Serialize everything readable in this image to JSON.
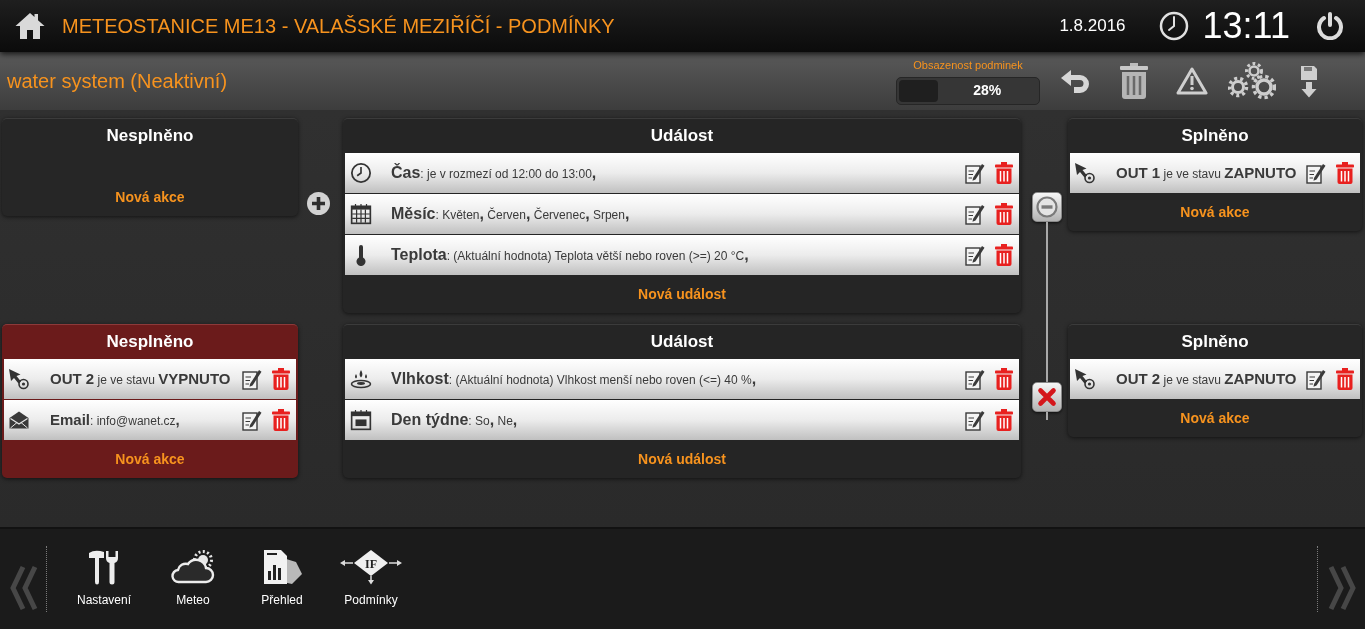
{
  "header": {
    "title": "METEOSTANICE ME13 - VALAŠSKÉ MEZIŘÍČÍ - PODMÍNKY",
    "date": "1.8.2016",
    "time": "13:11"
  },
  "toolbar": {
    "title": "water system (Neaktivní)",
    "occupancy": {
      "label": "Obsazenost podminek",
      "level": 0.28,
      "reading": "28%"
    }
  },
  "rules": [
    {
      "add_button": true,
      "link_button": {
        "kind": "remove"
      },
      "unmet": {
        "title": "Nesplněno",
        "active": false,
        "new_label": "Nová akce"
      },
      "event": {
        "title": "Událost",
        "conditions": [
          {
            "kind": "time",
            "text": "**Čas**: je v rozmezí od 12:00 do 13:00**,**"
          },
          {
            "kind": "month",
            "text": "**Měsíc**: Květen**,** Červen**,** Červenec**,** Srpen**,**"
          },
          {
            "kind": "temperature",
            "text": "**Teplota**: (Aktuální hodnota) Teplota větší nebo roven (>=) 20 °C**,**"
          }
        ],
        "new_label": "Nová událost"
      },
      "met": {
        "title": "Splněno",
        "active": false,
        "actions": [
          {
            "kind": "output",
            "text": "**OUT 1** je ve stavu **ZAPNUTO**"
          }
        ],
        "new_label": "Nová akce"
      }
    },
    {
      "link_button": {
        "kind": "delete"
      },
      "unmet": {
        "title": "Nesplněno",
        "active": true,
        "actions": [
          {
            "kind": "output",
            "text": "**OUT 2** je ve stavu **VYPNUTO**"
          },
          {
            "kind": "email",
            "text": "**Email**: info@wanet.cz**,**"
          }
        ],
        "new_label": "Nová akce"
      },
      "event": {
        "title": "Událost",
        "conditions": [
          {
            "kind": "humidity",
            "text": "**Vlhkost**: (Aktuální hodnota) Vlhkost menší nebo roven (<=) 40 %**,**"
          },
          {
            "kind": "weekday",
            "text": "**Den týdne**: So**,** Ne**,**"
          }
        ],
        "new_label": "Nová událost"
      },
      "met": {
        "title": "Splněno",
        "active": false,
        "actions": [
          {
            "kind": "output",
            "text": "**OUT 2** je ve stavu **ZAPNUTO**"
          }
        ],
        "new_label": "Nová akce"
      }
    }
  ],
  "nav": [
    {
      "kind": "settings",
      "label": "Nastavení"
    },
    {
      "kind": "weather",
      "label": "Meteo"
    },
    {
      "kind": "overview",
      "label": "Přehled"
    },
    {
      "kind": "conditions",
      "label": "Podmínky",
      "icon_text": "IF"
    }
  ]
}
